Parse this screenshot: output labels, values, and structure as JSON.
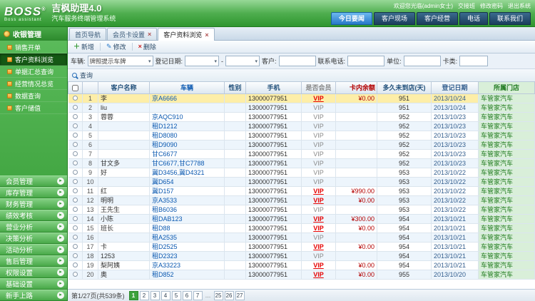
{
  "colors": {
    "accent_green": "#3da23d",
    "vip_red": "#e60000",
    "nav_active_blue": "#2878c8",
    "store_green": "#1f7a1f",
    "selected_row_yellow": "#fdeea8"
  },
  "header": {
    "logo_text": "BOSS",
    "logo_reg": "®",
    "logo_sub": "Boss assistant",
    "title": "吉枫助理4.0",
    "subtitle": "汽车服务终端管理系统",
    "welcome": "欢迎您光临(admin女士)",
    "links": [
      "交接班",
      "修改密码",
      "退出系统"
    ],
    "nav": [
      {
        "label": "今日要闻",
        "active": true
      },
      {
        "label": "客户现场",
        "active": false
      },
      {
        "label": "客户经营",
        "active": false
      },
      {
        "label": "电话",
        "active": false
      },
      {
        "label": "联系我们",
        "active": false
      }
    ]
  },
  "sidebar": {
    "section": "收银管理",
    "items": [
      {
        "label": "销售开单",
        "active": false
      },
      {
        "label": "客户资料浏览",
        "active": true
      },
      {
        "label": "单据汇总查询",
        "active": false
      },
      {
        "label": "经营情况总览",
        "active": false
      },
      {
        "label": "数据查询",
        "active": false
      },
      {
        "label": "客户储值",
        "active": false
      }
    ],
    "accordions": [
      "会员管理",
      "库存管理",
      "财务管理",
      "绩效考核",
      "营业分析",
      "决策分析",
      "活动分析",
      "售后管理",
      "权限设置",
      "基础设置",
      "新手上路"
    ]
  },
  "tabs": [
    {
      "label": "首页导航",
      "active": false,
      "closable": false
    },
    {
      "label": "会员卡设置",
      "active": false,
      "closable": true
    },
    {
      "label": "客户资料浏览",
      "active": true,
      "closable": true
    }
  ],
  "toolbar": [
    {
      "label": "新增",
      "icon": "plus"
    },
    {
      "label": "修改",
      "icon": "edit"
    },
    {
      "label": "删除",
      "icon": "delete"
    }
  ],
  "filters": {
    "vehicle_label": "车辆:",
    "vehicle_value": "牌照提示车牌",
    "date_label": "登记日期:",
    "range_dash": "-",
    "customer_label": "客户:",
    "phone_label": "联系电话:",
    "unit_label": "单位:",
    "card_label": "卡类:",
    "search_label": "查询"
  },
  "table": {
    "columns": [
      "",
      "",
      "客户名称",
      "车辆",
      "性别",
      "手机",
      "是否会员",
      "卡内余额",
      "多久未到店(天)",
      "登记日期",
      "所属门店"
    ],
    "rows": [
      {
        "seq": 1,
        "name": "李",
        "vehicle": "京A6666",
        "gender": "",
        "phone": "13000077951",
        "vip": "VIP",
        "vip_strong": true,
        "balance": "¥0.00",
        "days": "951",
        "date": "2013/10/24",
        "store": "车管家汽车",
        "selected": true
      },
      {
        "seq": 2,
        "name": "liu",
        "vehicle": "",
        "gender": "",
        "phone": "13000077951",
        "vip": "VIP",
        "vip_strong": false,
        "balance": "",
        "days": "951",
        "date": "2013/10/24",
        "store": "车管家汽车",
        "selected": false
      },
      {
        "seq": 3,
        "name": "蓉蓉",
        "vehicle": "京AQC910",
        "gender": "",
        "phone": "13000077951",
        "vip": "VIP",
        "vip_strong": false,
        "balance": "",
        "days": "952",
        "date": "2013/10/23",
        "store": "车管家汽车",
        "selected": false
      },
      {
        "seq": 4,
        "name": "",
        "vehicle": "租D1212",
        "gender": "",
        "phone": "13000077951",
        "vip": "VIP",
        "vip_strong": false,
        "balance": "",
        "days": "952",
        "date": "2013/10/23",
        "store": "车管家汽车",
        "selected": false
      },
      {
        "seq": 5,
        "name": "",
        "vehicle": "租D8080",
        "gender": "",
        "phone": "13000077951",
        "vip": "VIP",
        "vip_strong": false,
        "balance": "",
        "days": "952",
        "date": "2013/10/23",
        "store": "车管家汽车",
        "selected": false
      },
      {
        "seq": 6,
        "name": "",
        "vehicle": "租D9090",
        "gender": "",
        "phone": "13000077951",
        "vip": "VIP",
        "vip_strong": false,
        "balance": "",
        "days": "952",
        "date": "2013/10/23",
        "store": "车管家汽车",
        "selected": false
      },
      {
        "seq": 7,
        "name": "",
        "vehicle": "甘C6677",
        "gender": "",
        "phone": "13000077951",
        "vip": "VIP",
        "vip_strong": false,
        "balance": "",
        "days": "952",
        "date": "2013/10/23",
        "store": "车管家汽车",
        "selected": false
      },
      {
        "seq": 8,
        "name": "甘文多",
        "vehicle": "甘C6677,甘C7788",
        "gender": "",
        "phone": "13000077951",
        "vip": "VIP",
        "vip_strong": false,
        "balance": "",
        "days": "952",
        "date": "2013/10/23",
        "store": "车管家汽车",
        "selected": false
      },
      {
        "seq": 9,
        "name": "好",
        "vehicle": "冀D3456,冀D4321",
        "gender": "",
        "phone": "13000077951",
        "vip": "VIP",
        "vip_strong": false,
        "balance": "",
        "days": "953",
        "date": "2013/10/22",
        "store": "车管家汽车",
        "selected": false
      },
      {
        "seq": 10,
        "name": "",
        "vehicle": "冀D654",
        "gender": "",
        "phone": "13000077951",
        "vip": "VIP",
        "vip_strong": false,
        "balance": "",
        "days": "953",
        "date": "2013/10/22",
        "store": "车管家汽车",
        "selected": false
      },
      {
        "seq": 11,
        "name": "红",
        "vehicle": "冀D157",
        "gender": "",
        "phone": "13000077951",
        "vip": "VIP",
        "vip_strong": true,
        "balance": "¥990.00",
        "days": "953",
        "date": "2013/10/22",
        "store": "车管家汽车",
        "selected": false
      },
      {
        "seq": 12,
        "name": "明明",
        "vehicle": "京A3533",
        "gender": "",
        "phone": "13000077951",
        "vip": "VIP",
        "vip_strong": true,
        "balance": "¥0.00",
        "days": "953",
        "date": "2013/10/22",
        "store": "车管家汽车",
        "selected": false
      },
      {
        "seq": 13,
        "name": "王先生",
        "vehicle": "租B6036",
        "gender": "",
        "phone": "13000077951",
        "vip": "VIP",
        "vip_strong": false,
        "balance": "",
        "days": "953",
        "date": "2013/10/22",
        "store": "车管家汽车",
        "selected": false
      },
      {
        "seq": 14,
        "name": "小陈",
        "vehicle": "租DAB123",
        "gender": "",
        "phone": "13000077951",
        "vip": "VIP",
        "vip_strong": true,
        "balance": "¥300.00",
        "days": "954",
        "date": "2013/10/21",
        "store": "车管家汽车",
        "selected": false
      },
      {
        "seq": 15,
        "name": "班长",
        "vehicle": "租D88",
        "gender": "",
        "phone": "13000077951",
        "vip": "VIP",
        "vip_strong": true,
        "balance": "¥0.00",
        "days": "954",
        "date": "2013/10/21",
        "store": "车管家汽车",
        "selected": false
      },
      {
        "seq": 16,
        "name": "",
        "vehicle": "租A2535",
        "gender": "",
        "phone": "13000077951",
        "vip": "VIP",
        "vip_strong": false,
        "balance": "",
        "days": "954",
        "date": "2013/10/21",
        "store": "车管家汽车",
        "selected": false
      },
      {
        "seq": 17,
        "name": "卡",
        "vehicle": "租D2525",
        "gender": "",
        "phone": "13000077951",
        "vip": "VIP",
        "vip_strong": true,
        "balance": "¥0.00",
        "days": "954",
        "date": "2013/10/21",
        "store": "车管家汽车",
        "selected": false
      },
      {
        "seq": 18,
        "name": "1253",
        "vehicle": "租D2323",
        "gender": "",
        "phone": "13000077951",
        "vip": "VIP",
        "vip_strong": false,
        "balance": "",
        "days": "954",
        "date": "2013/10/21",
        "store": "车管家汽车",
        "selected": false
      },
      {
        "seq": 19,
        "name": "梨阿姨",
        "vehicle": "京A33223",
        "gender": "",
        "phone": "13000077951",
        "vip": "VIP",
        "vip_strong": true,
        "balance": "¥0.00",
        "days": "954",
        "date": "2013/10/21",
        "store": "车管家汽车",
        "selected": false
      },
      {
        "seq": 20,
        "name": "奥",
        "vehicle": "租D852",
        "gender": "",
        "phone": "13000077951",
        "vip": "VIP",
        "vip_strong": true,
        "balance": "¥0.00",
        "days": "955",
        "date": "2013/10/20",
        "store": "车管家汽车",
        "selected": false
      }
    ]
  },
  "pagination": {
    "info": "第1/27页(共539条)",
    "pages": [
      "1",
      "2",
      "3",
      "4",
      "5",
      "6",
      "7",
      "…",
      "25",
      "26",
      "27"
    ],
    "active": "1"
  }
}
